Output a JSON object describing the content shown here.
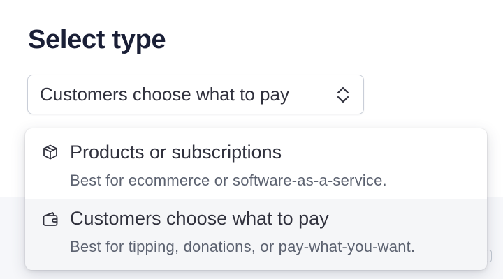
{
  "page": {
    "title": "Select type"
  },
  "select": {
    "value": "Customers choose what to pay",
    "icon": "chevron-up-down-icon"
  },
  "dropdown": {
    "options": [
      {
        "title": "Products or subscriptions",
        "description": "Best for ecommerce or software-as-a-service.",
        "icon": "box-icon",
        "highlighted": false
      },
      {
        "title": "Customers choose what to pay",
        "description": "Best for tipping, donations, or pay-what-you-want.",
        "icon": "wallet-icon",
        "highlighted": true
      }
    ]
  },
  "colors": {
    "text_primary": "#30313d",
    "heading": "#1a1f36",
    "text_secondary": "#5c6270",
    "highlight_bg": "#f5f6f8",
    "border": "#c9ced8"
  }
}
